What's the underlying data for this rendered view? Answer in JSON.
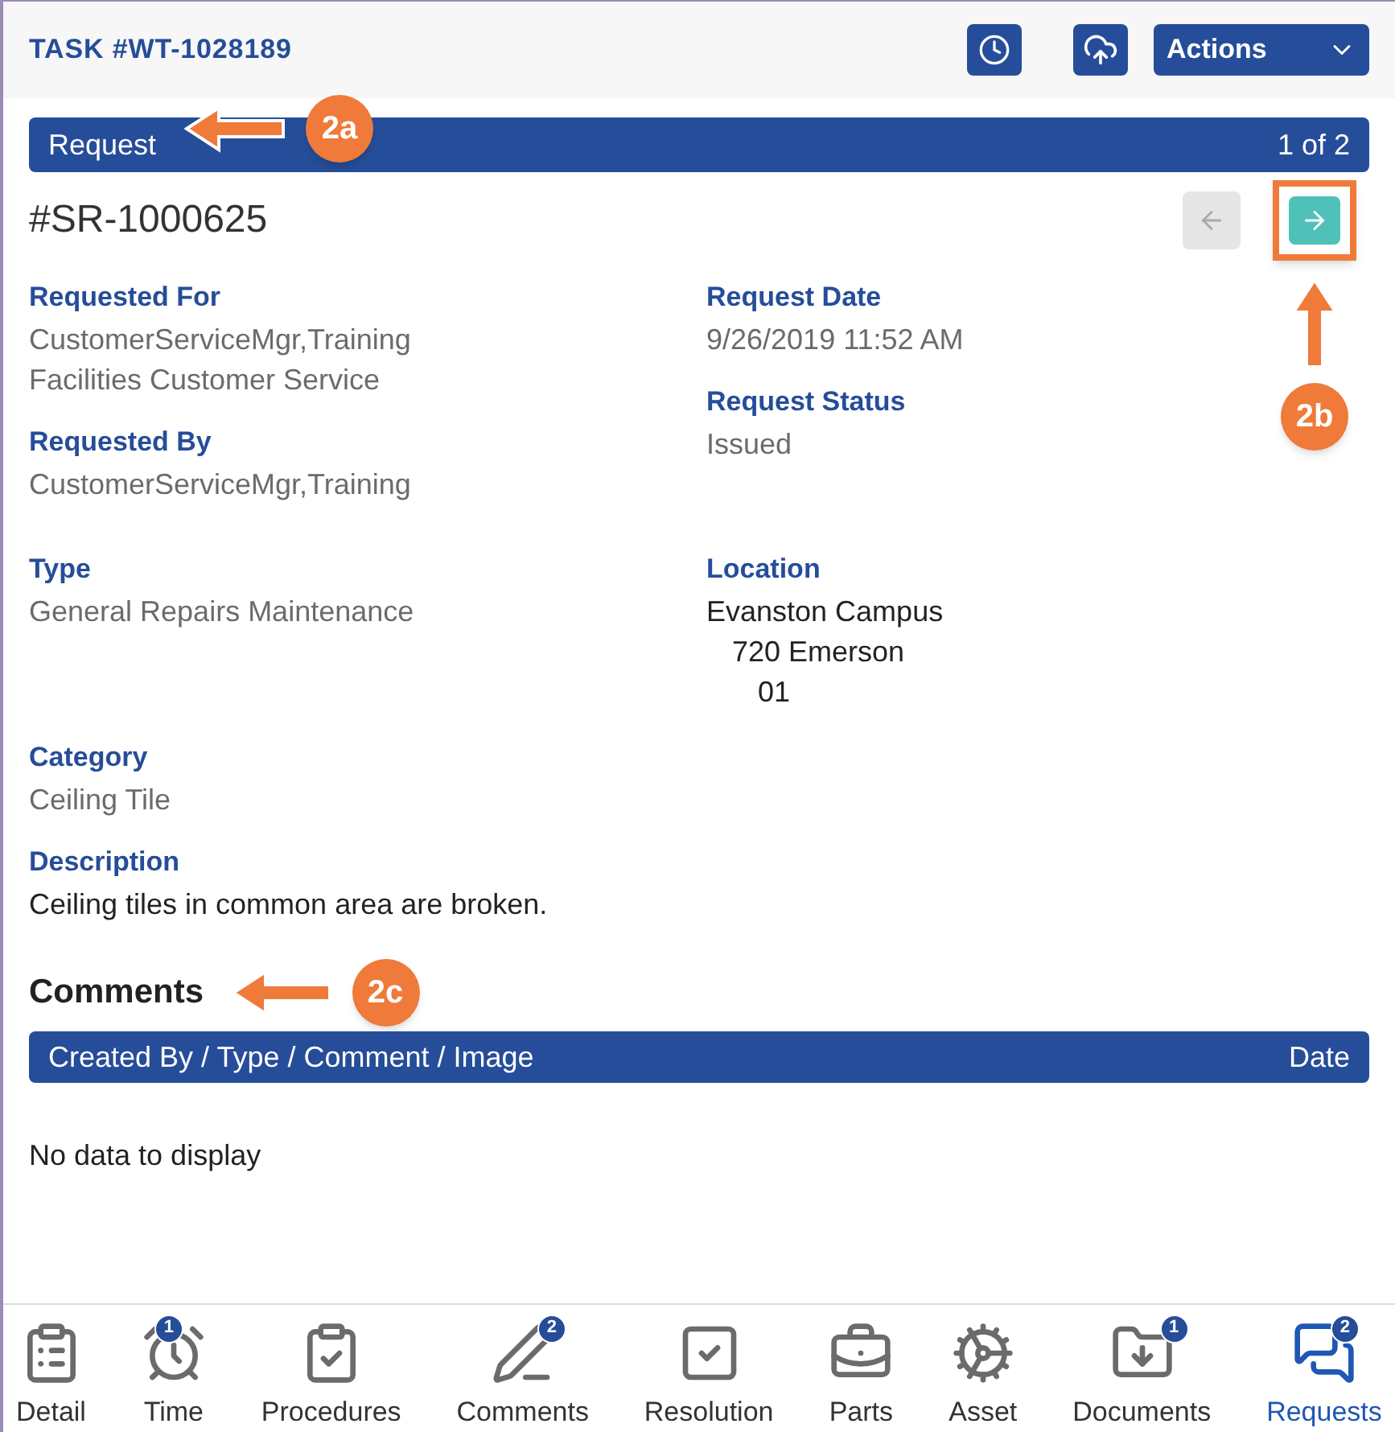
{
  "header": {
    "title": "TASK #WT-1028189",
    "actions_label": "Actions"
  },
  "section": {
    "title": "Request",
    "pager": "1 of 2",
    "callout": "2a"
  },
  "record": {
    "number": "#SR-1000625",
    "prev_disabled": true,
    "next_disabled": false,
    "callout": "2b"
  },
  "field_rows": [
    {
      "columns": [
        {
          "fields": [
            {
              "label": "Requested For",
              "lines": [
                {
                  "text": "CustomerServiceMgr,Training"
                },
                {
                  "text": "Facilities Customer Service"
                }
              ]
            },
            {
              "label": "Requested By",
              "lines": [
                {
                  "text": "CustomerServiceMgr,Training"
                }
              ]
            }
          ]
        },
        {
          "fields": [
            {
              "label": "Request Date",
              "lines": [
                {
                  "text": "9/26/2019 11:52 AM"
                }
              ]
            },
            {
              "label": "Request Status",
              "lines": [
                {
                  "text": "Issued"
                }
              ]
            }
          ]
        }
      ]
    },
    {
      "columns": [
        {
          "fields": [
            {
              "label": "Type",
              "lines": [
                {
                  "text": "General Repairs Maintenance"
                }
              ]
            }
          ]
        },
        {
          "fields": [
            {
              "label": "Location",
              "dark": true,
              "lines": [
                {
                  "text": "Evanston Campus",
                  "children": [
                    {
                      "text": "720 Emerson",
                      "children": [
                        {
                          "text": "01"
                        }
                      ]
                    }
                  ]
                }
              ]
            }
          ]
        }
      ]
    },
    {
      "columns": [
        {
          "fields": [
            {
              "label": "Category",
              "lines": [
                {
                  "text": "Ceiling Tile"
                }
              ]
            },
            {
              "label": "Description",
              "dark": true,
              "lines": [
                {
                  "text": "Ceiling tiles in common area are broken."
                }
              ]
            }
          ]
        }
      ]
    }
  ],
  "comments": {
    "title": "Comments",
    "callout": "2c",
    "columns": [
      "Created By / Type / Comment / Image",
      "Date"
    ],
    "empty": "No data to display"
  },
  "nav": [
    {
      "kind": "detail",
      "label": "Detail",
      "selected": false
    },
    {
      "kind": "time",
      "label": "Time",
      "badge": "1",
      "selected": false
    },
    {
      "kind": "procedures",
      "label": "Procedures",
      "selected": false
    },
    {
      "kind": "comments",
      "label": "Comments",
      "badge": "2",
      "selected": false
    },
    {
      "kind": "resolution",
      "label": "Resolution",
      "selected": false
    },
    {
      "kind": "parts",
      "label": "Parts",
      "selected": false
    },
    {
      "kind": "asset",
      "label": "Asset",
      "selected": false
    },
    {
      "kind": "documents",
      "label": "Documents",
      "badge": "1",
      "selected": false
    },
    {
      "kind": "requests",
      "label": "Requests",
      "badge": "2",
      "selected": true
    }
  ]
}
